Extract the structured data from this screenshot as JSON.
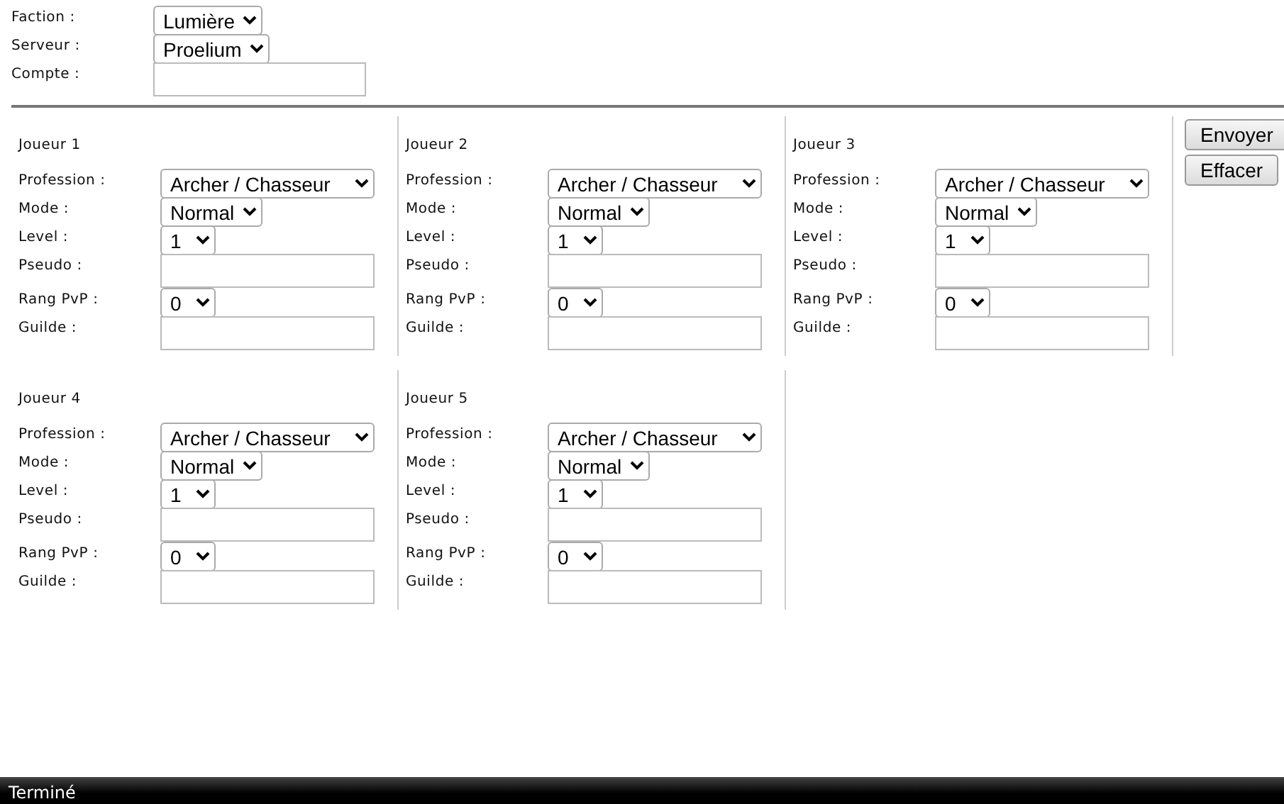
{
  "account": [
    {
      "label": "Faction :",
      "kind": "select",
      "value": "Lumière"
    },
    {
      "label": "Serveur :",
      "kind": "select",
      "value": "Proelium"
    },
    {
      "label": "Compte :",
      "kind": "text"
    }
  ],
  "players": [
    {
      "title": "Joueur 1",
      "fields": [
        {
          "label": "Profession :",
          "kind": "select",
          "value": "Archer / Chasseur"
        },
        {
          "label": "Mode :",
          "kind": "select",
          "value": "Normal"
        },
        {
          "label": "Level :",
          "kind": "select",
          "value": "1"
        },
        {
          "label": "Pseudo :",
          "kind": "text"
        },
        {
          "label": "Rang PvP :",
          "kind": "select",
          "value": "0"
        },
        {
          "label": "Guilde :",
          "kind": "text"
        }
      ]
    },
    {
      "title": "Joueur 2",
      "fields": [
        {
          "label": "Profession :",
          "kind": "select",
          "value": "Archer / Chasseur"
        },
        {
          "label": "Mode :",
          "kind": "select",
          "value": "Normal"
        },
        {
          "label": "Level :",
          "kind": "select",
          "value": "1"
        },
        {
          "label": "Pseudo :",
          "kind": "text"
        },
        {
          "label": "Rang PvP :",
          "kind": "select",
          "value": "0"
        },
        {
          "label": "Guilde :",
          "kind": "text"
        }
      ]
    },
    {
      "title": "Joueur 3",
      "fields": [
        {
          "label": "Profession :",
          "kind": "select",
          "value": "Archer / Chasseur"
        },
        {
          "label": "Mode :",
          "kind": "select",
          "value": "Normal"
        },
        {
          "label": "Level :",
          "kind": "select",
          "value": "1"
        },
        {
          "label": "Pseudo :",
          "kind": "text"
        },
        {
          "label": "Rang PvP :",
          "kind": "select",
          "value": "0"
        },
        {
          "label": "Guilde :",
          "kind": "text"
        }
      ]
    },
    {
      "title": "Joueur 4",
      "fields": [
        {
          "label": "Profession :",
          "kind": "select",
          "value": "Archer / Chasseur"
        },
        {
          "label": "Mode :",
          "kind": "select",
          "value": "Normal"
        },
        {
          "label": "Level :",
          "kind": "select",
          "value": "1"
        },
        {
          "label": "Pseudo :",
          "kind": "text"
        },
        {
          "label": "Rang PvP :",
          "kind": "select",
          "value": "0"
        },
        {
          "label": "Guilde :",
          "kind": "text"
        }
      ]
    },
    {
      "title": "Joueur 5",
      "fields": [
        {
          "label": "Profession :",
          "kind": "select",
          "value": "Archer / Chasseur"
        },
        {
          "label": "Mode :",
          "kind": "select",
          "value": "Normal"
        },
        {
          "label": "Level :",
          "kind": "select",
          "value": "1"
        },
        {
          "label": "Pseudo :",
          "kind": "text"
        },
        {
          "label": "Rang PvP :",
          "kind": "select",
          "value": "0"
        },
        {
          "label": "Guilde :",
          "kind": "text"
        }
      ]
    }
  ],
  "buttons": [
    "Envoyer",
    "Effacer"
  ],
  "status_bar": "Terminé"
}
